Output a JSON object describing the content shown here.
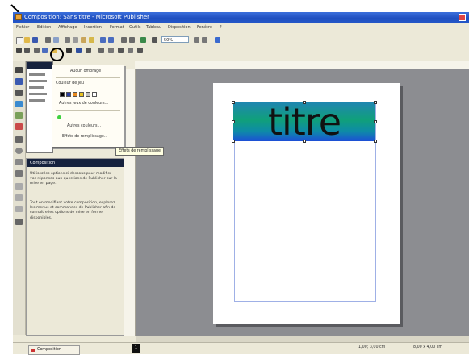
{
  "window": {
    "title": "Composition: Sans titre - Microsoft Publisher"
  },
  "menubar": {
    "items": [
      "Fichier",
      "Edition",
      "Affichage",
      "Insertion",
      "Format",
      "Outils",
      "Tableau",
      "Disposition",
      "Fenêtre",
      "?"
    ]
  },
  "toolbar": {
    "zoom_value": "50%"
  },
  "task_pane": {
    "title": "Composition",
    "paragraph_1": "Utilisez les options ci-dessous pour modifier vos réponses aux questions de Publisher sur la mise en page.",
    "paragraph_2": "Tout en modifiant votre composition, explorez les menus et commandes de Publisher afin de connaître les options de mise en forme disponibles."
  },
  "dropdown": {
    "no_shadow": "Aucun ombrage",
    "shadow_color_label": "Couleur de jeu",
    "more_colors": "Autres jeux de couleurs...",
    "more_fills": "Autres couleurs...",
    "fill_effects": "Effets de remplissage...",
    "swatch_colors": [
      "#000000",
      "#2a3f9f",
      "#e98a1f",
      "#e9c21f",
      "#c0c0c0",
      "#ffffff"
    ],
    "accent_color": "#3fd23f"
  },
  "tooltip": {
    "text": "Effets de remplissage"
  },
  "document": {
    "title_text": "titre"
  },
  "statusbar": {
    "sheet_tab": "Composition",
    "page_number": "1",
    "pos_label": "1,00; 3,00 cm",
    "size_label": "8,00 x 4,00 cm"
  },
  "colors": {
    "titlebar": "#2457c8",
    "workspace": "#8c8d91",
    "title_fill_top": "#1f86b0",
    "title_fill_mid": "#10a07a",
    "title_fill_bottom": "#1c4fd6"
  }
}
